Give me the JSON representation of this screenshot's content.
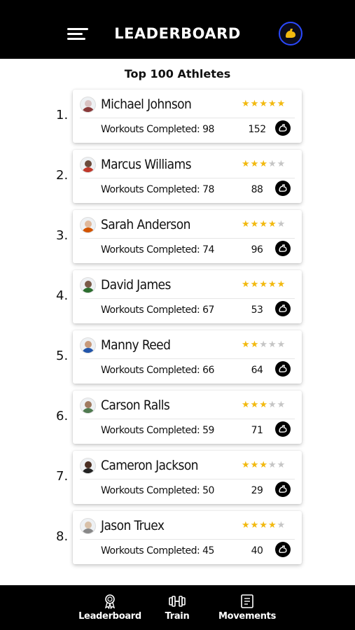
{
  "header": {
    "title": "LEADERBOARD",
    "menu_icon": "hamburger-menu-icon",
    "profile_icon": "flexed-bicep-icon",
    "profile_color": "#f2b90f",
    "accent_border": "#2a49ff"
  },
  "subtitle": "Top 100 Athletes",
  "star_colors": {
    "on": "#f2b90f",
    "off": "#c5c5c5"
  },
  "athletes": [
    {
      "rank": "1.",
      "name": "Michael Johnson",
      "stars": 5,
      "workouts": "Workouts Completed: 98",
      "points": "152",
      "avatar_colors": [
        "#d9c2c2",
        "#8a3a3a"
      ]
    },
    {
      "rank": "2.",
      "name": "Marcus Williams",
      "stars": 3,
      "workouts": "Workouts Completed: 78",
      "points": "88",
      "avatar_colors": [
        "#6b4a3a",
        "#c0392b"
      ]
    },
    {
      "rank": "3.",
      "name": "Sarah Anderson",
      "stars": 4,
      "workouts": "Workouts Completed: 74",
      "points": "96",
      "avatar_colors": [
        "#e0b89a",
        "#d35400"
      ]
    },
    {
      "rank": "4.",
      "name": "David James",
      "stars": 5,
      "workouts": "Workouts Completed: 67",
      "points": "53",
      "avatar_colors": [
        "#7a5a48",
        "#2c6e2f"
      ]
    },
    {
      "rank": "5.",
      "name": "Manny Reed",
      "stars": 2,
      "workouts": "Workouts Completed: 66",
      "points": "64",
      "avatar_colors": [
        "#c89a7a",
        "#2255aa"
      ]
    },
    {
      "rank": "6.",
      "name": "Carson Ralls",
      "stars": 3,
      "workouts": "Workouts Completed: 59",
      "points": "71",
      "avatar_colors": [
        "#a07a60",
        "#4f7a4f"
      ]
    },
    {
      "rank": "7.",
      "name": "Cameron Jackson",
      "stars": 3,
      "workouts": "Workouts Completed: 50",
      "points": "29",
      "avatar_colors": [
        "#4a2e22",
        "#222222"
      ]
    },
    {
      "rank": "8.",
      "name": "Jason Truex",
      "stars": 4,
      "workouts": "Workouts Completed: 45",
      "points": "40",
      "avatar_colors": [
        "#d8c0a8",
        "#888888"
      ]
    }
  ],
  "bottom_nav": {
    "items": [
      {
        "label": "Leaderboard",
        "icon": "medal-icon"
      },
      {
        "label": "Train",
        "icon": "dumbbell-icon"
      },
      {
        "label": "Movements",
        "icon": "book-icon"
      }
    ]
  }
}
